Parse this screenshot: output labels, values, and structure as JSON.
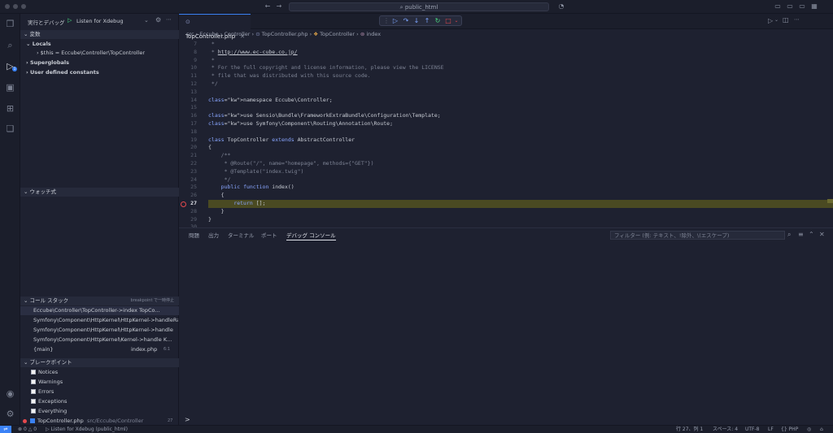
{
  "window": {
    "search_text": "public_html"
  },
  "run_view": {
    "header_title": "実行とデバッグ",
    "config_name": "Listen for Xdebug"
  },
  "variables": {
    "title": "変数",
    "locals_label": "Locals",
    "this_var": "$this = Eccube\\Controller\\TopController",
    "superglobals_label": "Superglobals",
    "user_constants_label": "User defined constants"
  },
  "watch": {
    "title": "ウォッチ式"
  },
  "call_stack": {
    "title": "コール スタック",
    "status": "breakpoint で一時停止",
    "frames": [
      {
        "name": "Eccube\\Controller\\TopController->index",
        "file": "TopCo..."
      },
      {
        "name": "Symfony\\Component\\HttpKernel\\HttpKernel->handleRaw",
        "file": ""
      },
      {
        "name": "Symfony\\Component\\HttpKernel\\HttpKernel->handle",
        "file": ""
      },
      {
        "name": "Symfony\\Component\\HttpKernel\\Kernel->handle",
        "file": "K..."
      },
      {
        "name": "{main}",
        "file": "index.php",
        "line": "6:1"
      }
    ]
  },
  "breakpoints": {
    "title": "ブレークポイント",
    "items": [
      "Notices",
      "Warnings",
      "Errors",
      "Exceptions",
      "Everything"
    ],
    "file_bp": {
      "name": "TopController.php",
      "path": "src/Eccube/Controller",
      "line": "27"
    }
  },
  "editor": {
    "tab_label": "TopController.php",
    "breadcrumb": [
      "src",
      "Eccube",
      "Controller",
      "TopController.php",
      "TopController",
      "index"
    ],
    "current_line": "27",
    "lines": [
      {
        "n": "7",
        "t": " *"
      },
      {
        "n": "8",
        "t": " * http://www.ec-cube.co.jp/"
      },
      {
        "n": "9",
        "t": " *"
      },
      {
        "n": "10",
        "t": " * For the full copyright and license information, please view the LICENSE"
      },
      {
        "n": "11",
        "t": " * file that was distributed with this source code."
      },
      {
        "n": "12",
        "t": " */"
      },
      {
        "n": "13",
        "t": ""
      },
      {
        "n": "14",
        "t": "namespace Eccube\\Controller;"
      },
      {
        "n": "15",
        "t": ""
      },
      {
        "n": "16",
        "t": "use Sensio\\Bundle\\FrameworkExtraBundle\\Configuration\\Template;"
      },
      {
        "n": "17",
        "t": "use Symfony\\Component\\Routing\\Annotation\\Route;"
      },
      {
        "n": "18",
        "t": ""
      },
      {
        "n": "19",
        "t": "class TopController extends AbstractController"
      },
      {
        "n": "20",
        "t": "{"
      },
      {
        "n": "21",
        "t": "    /**"
      },
      {
        "n": "22",
        "t": "     * @Route(\"/\", name=\"homepage\", methods={\"GET\"})"
      },
      {
        "n": "23",
        "t": "     * @Template(\"index.twig\")"
      },
      {
        "n": "24",
        "t": "     */"
      },
      {
        "n": "25",
        "t": "    public function index()"
      },
      {
        "n": "26",
        "t": "    {"
      },
      {
        "n": "27",
        "t": "        return [];"
      },
      {
        "n": "28",
        "t": "    }"
      },
      {
        "n": "29",
        "t": "}"
      },
      {
        "n": "30",
        "t": ""
      }
    ]
  },
  "panel": {
    "tabs": [
      "問題",
      "出力",
      "ターミナル",
      "ポート",
      "デバッグ コンソール"
    ],
    "filter_placeholder": "フィルター (例: テキスト、!除外、\\(エスケープ)",
    "prompt": ">"
  },
  "statusbar": {
    "errors": "0",
    "warnings": "0",
    "debug_config": "Listen for Xdebug (public_html)",
    "position": "行 27、列 1",
    "spaces": "スペース: 4",
    "encoding": "UTF-8",
    "eol": "LF",
    "language": "PHP"
  },
  "colors": {
    "accent": "#3b82f6",
    "highlight_line": "#4a4a22",
    "breakpoint": "#e5484d"
  }
}
